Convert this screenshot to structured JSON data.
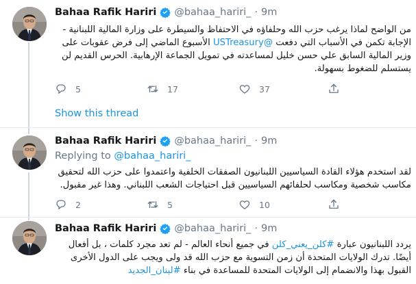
{
  "colors": {
    "link": "#1b95e0",
    "muted": "#657786",
    "verified": "#1da1f2",
    "separator": "#e6ecf0"
  },
  "tweets": [
    {
      "author_name": "Bahaa Rafik Hariri",
      "author_handle": "@bahaa_hariri_",
      "dot": "·",
      "time": "9m",
      "text_part1": "من الواضح لماذا يرغب حزب الله وحلفاؤه في الاحتفاظ والسيطرة على وزارة المالية اللبنانية - الإجابة تكمن في الأسباب التي دفعت ",
      "mention": "@USTreasury",
      "text_part2": " الأسبوع الماضي إلى فرض عقوبات على وزير المالية السابق علي حسن خليل لمساعدته في تمويل الجماعة الإرهابية.  الحرس القديم لن يستسلم للضغوط بسهولة.",
      "reply_count": "5",
      "retweet_count": "17",
      "like_count": "37",
      "show_thread": "Show this thread"
    },
    {
      "author_name": "Bahaa Rafik Hariri",
      "author_handle": "@bahaa_hariri_",
      "dot": "·",
      "time": "9m",
      "replying_label": "Replying to",
      "replying_handle": "@bahaa_hariri_",
      "text": "لقد استخدم هؤلاء القادة السياسيين اللبنانيون الصفقات الخلفية واعتمدوا على حزب الله لتحقيق مكاسب شخصية ومكاسب لحلفائهم السياسيين قبل احتياجات الشعب اللبناني. وهذا غير مقبول.",
      "reply_count": "2",
      "retweet_count": "5",
      "like_count": "10"
    },
    {
      "author_name": "Bahaa Rafik Hariri",
      "author_handle": "@bahaa_hariri_",
      "dot": "·",
      "time": "9m",
      "text_part1": "يردد اللبنانيون عبارة ",
      "hashtag1": "#كلن_يعني_كلن",
      "text_part2": " في جميع أنحاء العالم - لم تعد مجرد كلمات ، بل أفعال أيضًا. تدرك الولايات المتحدة أن زمن التسوية مع حزب الله قد ولى ويجب على الدول الأخرى القبول بهذا والانضمام إلى الولايات المتحدة للمساعدة في بناء ",
      "hashtag2": "#لبنان_الجديد"
    }
  ]
}
